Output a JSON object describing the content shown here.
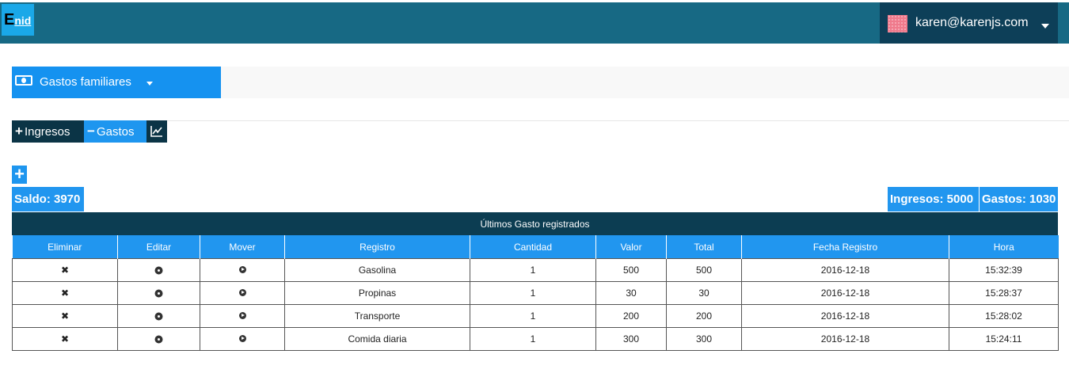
{
  "brand": {
    "logo_big": "E",
    "logo_small": "nid"
  },
  "user": {
    "email": "karen@karenjs.com"
  },
  "book": {
    "label": "Gastos familiares"
  },
  "tabs": [
    {
      "label": "Ingresos",
      "symbol": "+"
    },
    {
      "label": "Gastos",
      "symbol": "−"
    },
    {
      "icon": "chart-line-icon"
    }
  ],
  "add_symbol": "+",
  "summary": {
    "saldo": "Saldo: 3970",
    "ingresos": "Ingresos: 5000",
    "gastos": "Gastos: 1030"
  },
  "table": {
    "caption": "Últimos Gasto registrados",
    "columns": [
      "Eliminar",
      "Editar",
      "Mover",
      "Registro",
      "Cantidad",
      "Valor",
      "Total",
      "Fecha Registro",
      "Hora"
    ],
    "rows": [
      {
        "registro": "Gasolina",
        "cantidad": "1",
        "valor": "500",
        "total": "500",
        "fecha": "2016-12-18",
        "hora": "15:32:39"
      },
      {
        "registro": "Propinas",
        "cantidad": "1",
        "valor": "30",
        "total": "30",
        "fecha": "2016-12-18",
        "hora": "15:28:37"
      },
      {
        "registro": "Transporte",
        "cantidad": "1",
        "valor": "200",
        "total": "200",
        "fecha": "2016-12-18",
        "hora": "15:28:02"
      },
      {
        "registro": "Comida diaria",
        "cantidad": "1",
        "valor": "300",
        "total": "300",
        "fecha": "2016-12-18",
        "hora": "15:24:11"
      }
    ],
    "delete_symbol": "✖"
  },
  "colors": {
    "topbar": "#176984",
    "navy": "#0c3d52",
    "accent": "#2196ef"
  }
}
